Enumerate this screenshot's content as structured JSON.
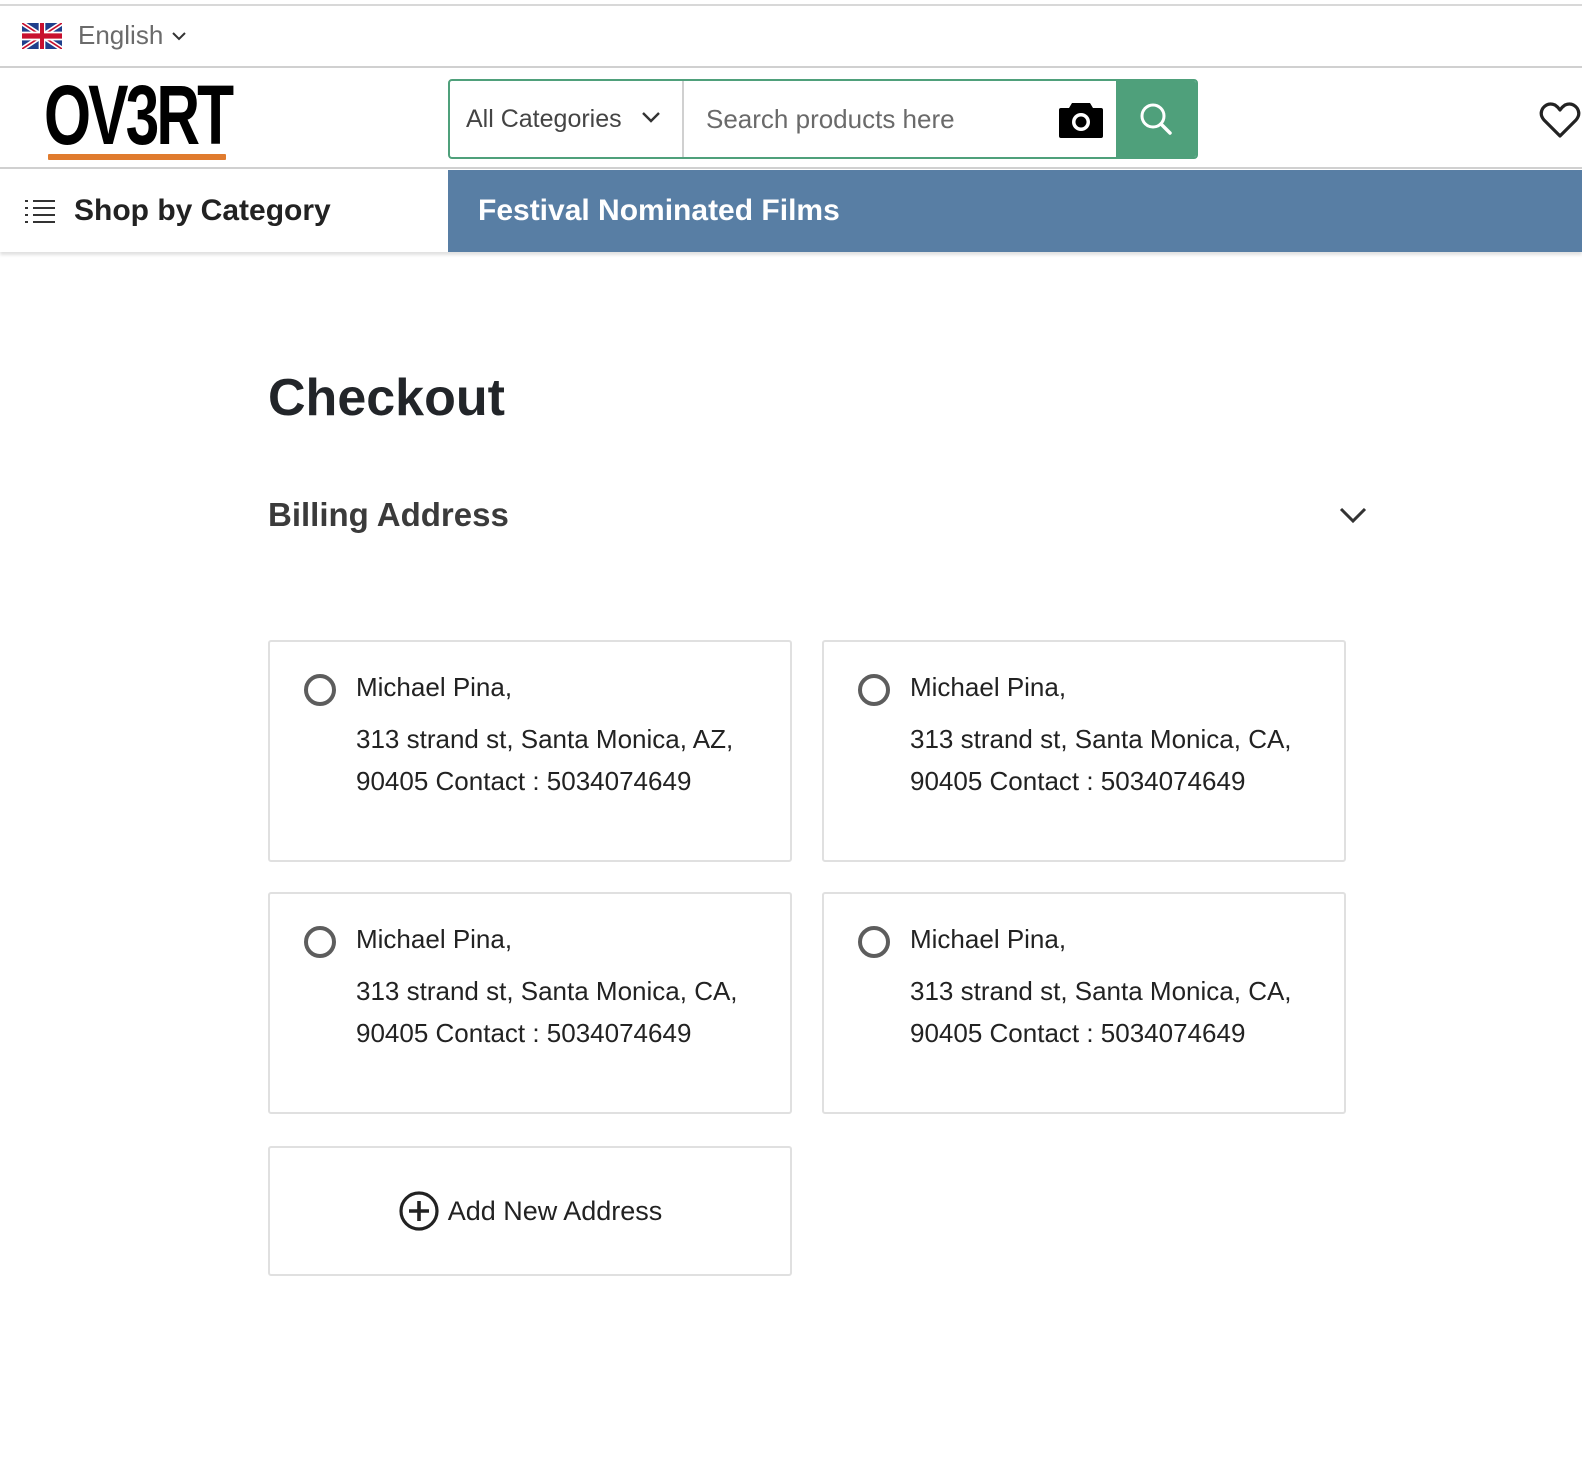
{
  "topbar": {
    "language": {
      "label": "English",
      "flag_icon": "uk-flag-icon"
    }
  },
  "header": {
    "logo_text": "OV3RT",
    "search": {
      "category_selected": "All Categories",
      "placeholder": "Search products here",
      "value": ""
    },
    "colors": {
      "accent_green": "#4fa07b",
      "logo_underline": "#e07b2e",
      "nav_blue": "#587ea4"
    }
  },
  "nav": {
    "shop_by_category": "Shop by Category",
    "promo_link": "Festival Nominated Films"
  },
  "main": {
    "title": "Checkout",
    "section_title": "Billing Address",
    "addresses": [
      {
        "name": "Michael Pina,",
        "line1": "313 strand st, Santa Monica, AZ,",
        "line2": "90405 Contact : 5034074649",
        "selected": false
      },
      {
        "name": "Michael Pina,",
        "line1": "313 strand st, Santa Monica, CA,",
        "line2": "90405 Contact : 5034074649",
        "selected": false
      },
      {
        "name": "Michael Pina,",
        "line1": "313 strand st, Santa Monica, CA,",
        "line2": "90405 Contact : 5034074649",
        "selected": false
      },
      {
        "name": "Michael Pina,",
        "line1": "313 strand st, Santa Monica, CA,",
        "line2": "90405 Contact : 5034074649",
        "selected": false
      }
    ],
    "add_new_address": "Add New Address"
  }
}
